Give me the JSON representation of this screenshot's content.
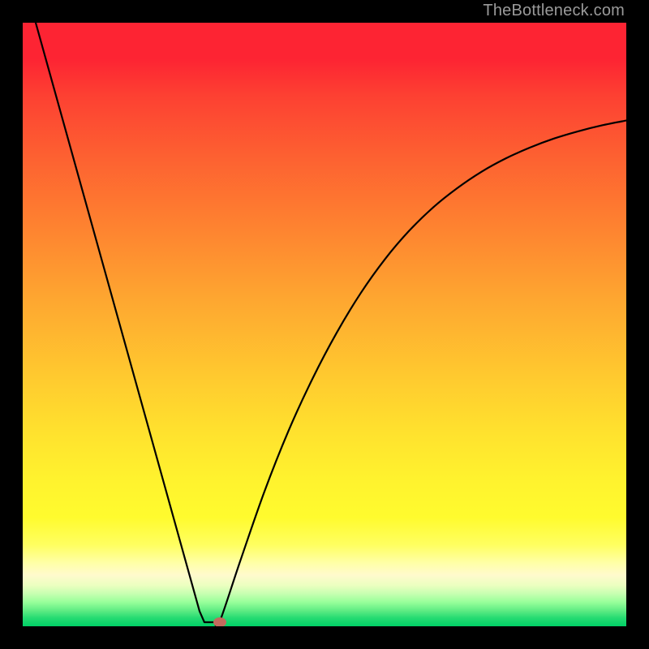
{
  "watermark": "TheBottleneck.com",
  "chart_data": {
    "type": "line",
    "title": "",
    "xlabel": "",
    "ylabel": "",
    "xlim": [
      0,
      1
    ],
    "ylim": [
      0,
      1
    ],
    "grid": false,
    "legend": false,
    "gradient_stops": [
      {
        "pos": 0.0,
        "color": "#fd2433"
      },
      {
        "pos": 0.06,
        "color": "#fd2433"
      },
      {
        "pos": 0.12,
        "color": "#fd4032"
      },
      {
        "pos": 0.22,
        "color": "#fd6031"
      },
      {
        "pos": 0.34,
        "color": "#fe8330"
      },
      {
        "pos": 0.46,
        "color": "#fea730"
      },
      {
        "pos": 0.58,
        "color": "#ffc82f"
      },
      {
        "pos": 0.68,
        "color": "#ffe22e"
      },
      {
        "pos": 0.76,
        "color": "#fff32e"
      },
      {
        "pos": 0.82,
        "color": "#fffb2e"
      },
      {
        "pos": 0.865,
        "color": "#ffff60"
      },
      {
        "pos": 0.895,
        "color": "#ffffa7"
      },
      {
        "pos": 0.915,
        "color": "#fffacd"
      },
      {
        "pos": 0.932,
        "color": "#ecffc0"
      },
      {
        "pos": 0.946,
        "color": "#c7ffb1"
      },
      {
        "pos": 0.96,
        "color": "#98ff9a"
      },
      {
        "pos": 0.974,
        "color": "#5fec84"
      },
      {
        "pos": 0.986,
        "color": "#26db72"
      },
      {
        "pos": 1.0,
        "color": "#00d166"
      }
    ],
    "series": [
      {
        "name": "bottleneck-curve",
        "points": [
          {
            "x": 0.0215,
            "y": 1.0
          },
          {
            "x": 0.293,
            "y": 0.025
          },
          {
            "x": 0.301,
            "y": 0.0067
          },
          {
            "x": 0.318,
            "y": 0.0067
          },
          {
            "x": 0.326,
            "y": 0.0067
          },
          {
            "x": 0.36,
            "y": 0.107
          },
          {
            "x": 0.4,
            "y": 0.222
          },
          {
            "x": 0.44,
            "y": 0.323
          },
          {
            "x": 0.48,
            "y": 0.41
          },
          {
            "x": 0.52,
            "y": 0.486
          },
          {
            "x": 0.56,
            "y": 0.552
          },
          {
            "x": 0.6,
            "y": 0.608
          },
          {
            "x": 0.64,
            "y": 0.655
          },
          {
            "x": 0.68,
            "y": 0.694
          },
          {
            "x": 0.72,
            "y": 0.726
          },
          {
            "x": 0.76,
            "y": 0.753
          },
          {
            "x": 0.8,
            "y": 0.775
          },
          {
            "x": 0.84,
            "y": 0.793
          },
          {
            "x": 0.88,
            "y": 0.808
          },
          {
            "x": 0.92,
            "y": 0.82
          },
          {
            "x": 0.96,
            "y": 0.83
          },
          {
            "x": 1.0,
            "y": 0.838
          }
        ]
      }
    ],
    "markers": [
      {
        "name": "optimal-point",
        "x": 0.326,
        "y": 0.0067,
        "shape": "ellipse",
        "color": "#c36a5d"
      }
    ]
  }
}
